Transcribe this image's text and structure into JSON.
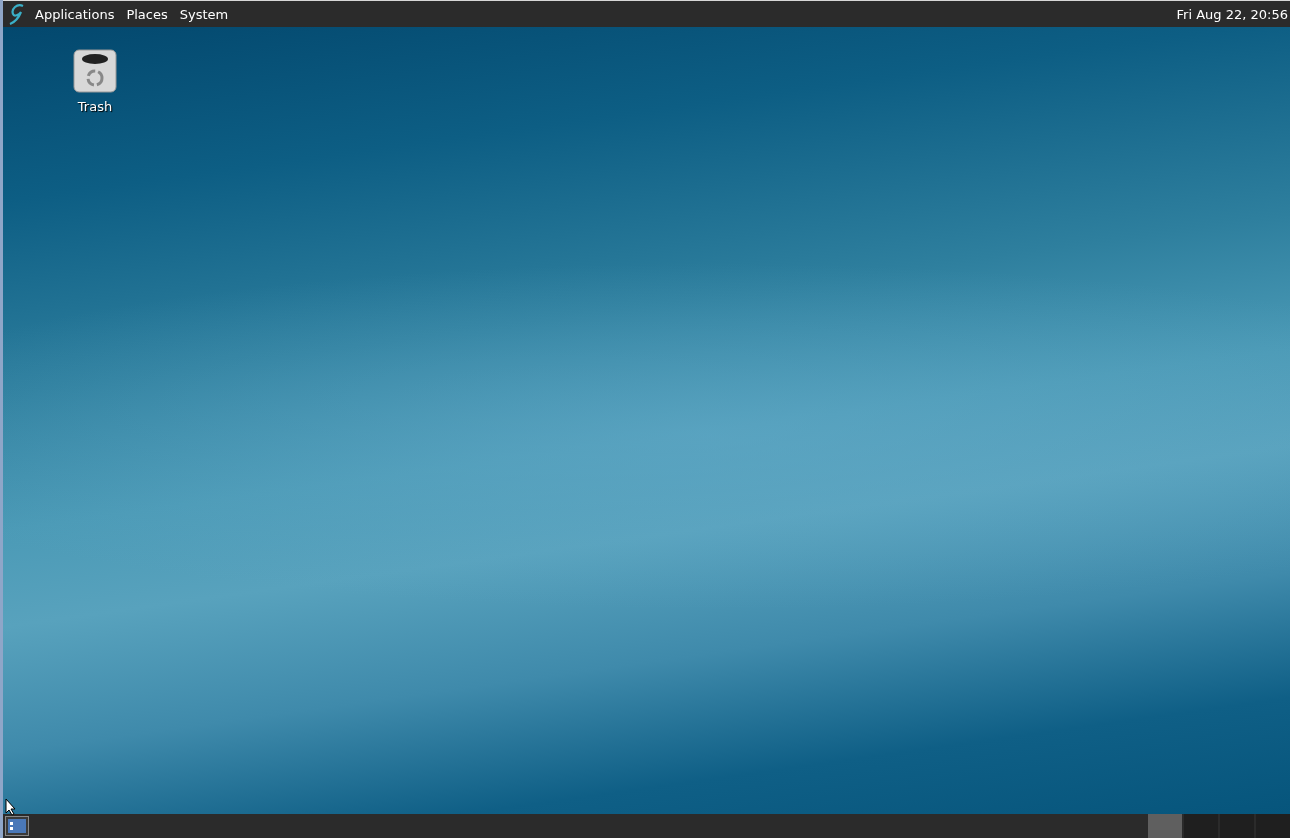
{
  "top_panel": {
    "menus": [
      "Applications",
      "Places",
      "System"
    ],
    "clock": "Fri Aug 22, 20:56"
  },
  "desktop": {
    "icons": [
      {
        "label": "Trash"
      }
    ]
  },
  "bottom_panel": {
    "workspaces": [
      {
        "selected": true
      },
      {
        "selected": false
      },
      {
        "selected": false
      },
      {
        "selected": false
      }
    ]
  }
}
